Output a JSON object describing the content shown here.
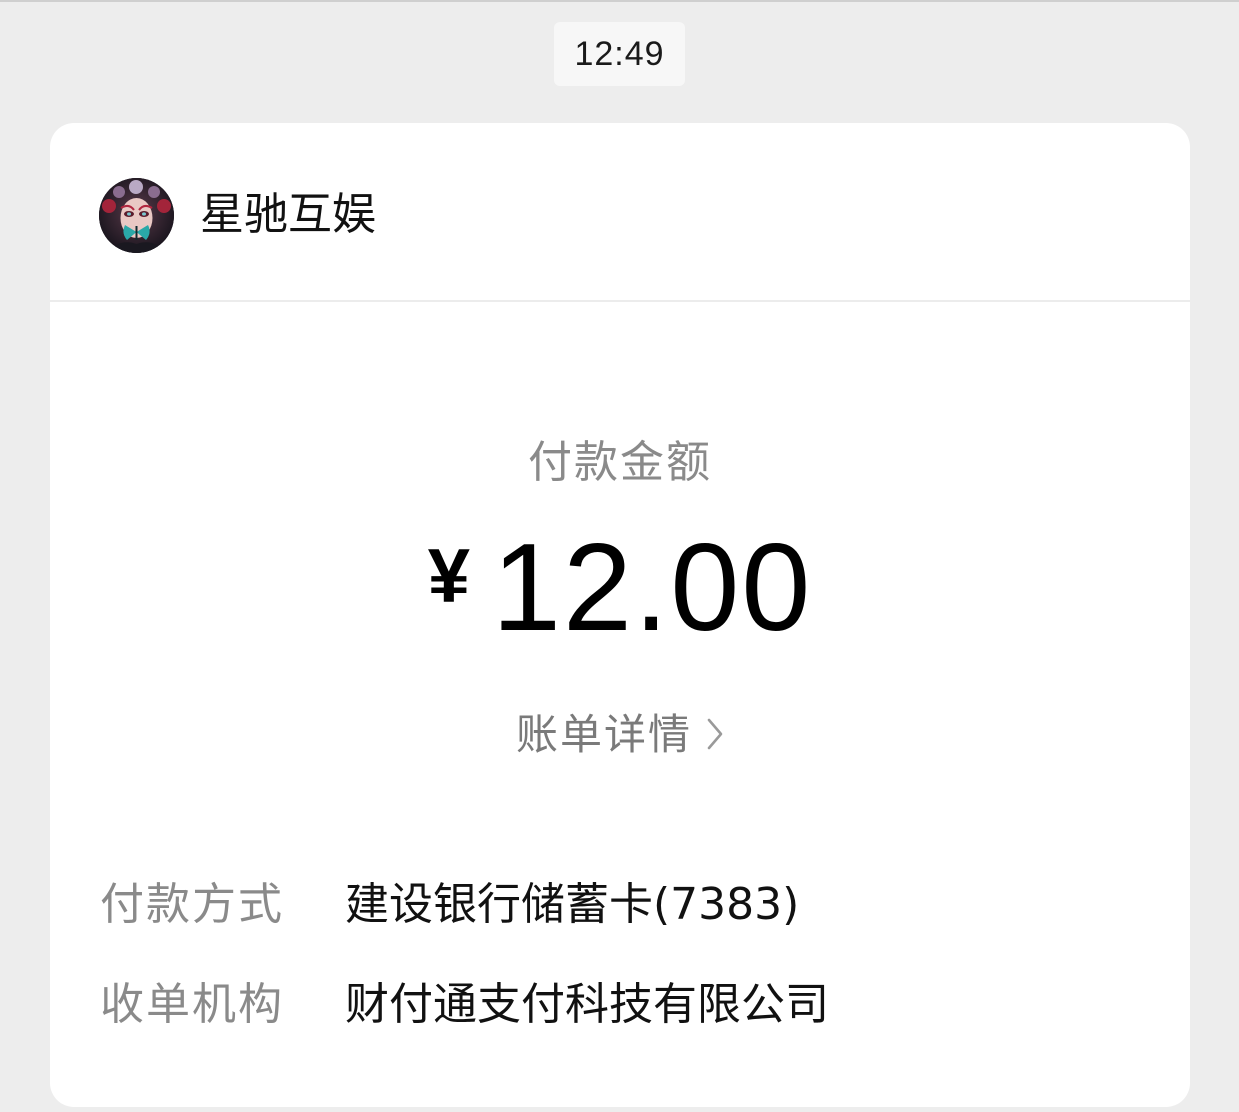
{
  "timestamp": "12:49",
  "merchant": {
    "name": "星驰互娱"
  },
  "payment": {
    "amount_label": "付款金额",
    "currency_symbol": "¥",
    "amount": "12.00",
    "bill_details_label": "账单详情"
  },
  "details": [
    {
      "label": "付款方式",
      "value": "建设银行储蓄卡(7383)"
    },
    {
      "label": "收单机构",
      "value": "财付通支付科技有限公司"
    }
  ],
  "colors": {
    "background": "#ededed",
    "card": "#ffffff",
    "muted_text": "#8a8a8a",
    "primary_text": "#111111"
  }
}
